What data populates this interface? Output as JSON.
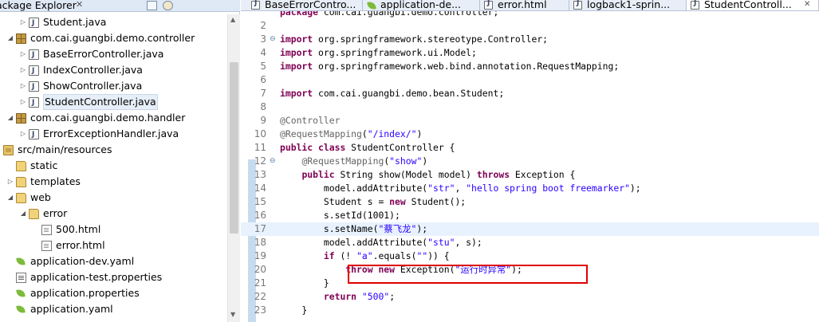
{
  "explorer": {
    "title": "Package Explorer",
    "close_icon": "close-icon",
    "tree": [
      {
        "label": "Student.java",
        "type": "java",
        "indent": 1,
        "arrow": "▷"
      },
      {
        "label": "com.cai.guangbi.demo.controller",
        "type": "package",
        "indent": 0,
        "arrow": "◢"
      },
      {
        "label": "BaseErrorController.java",
        "type": "java",
        "indent": 1,
        "arrow": "▷"
      },
      {
        "label": "IndexController.java",
        "type": "java",
        "indent": 1,
        "arrow": "▷"
      },
      {
        "label": "ShowController.java",
        "type": "java",
        "indent": 1,
        "arrow": "▷"
      },
      {
        "label": "StudentController.java",
        "type": "java",
        "indent": 1,
        "arrow": "▷",
        "selected": true
      },
      {
        "label": "com.cai.guangbi.demo.handler",
        "type": "package",
        "indent": 0,
        "arrow": "◢"
      },
      {
        "label": "ErrorExceptionHandler.java",
        "type": "java",
        "indent": 1,
        "arrow": "▷"
      },
      {
        "label": "src/main/resources",
        "type": "srcfolder",
        "indent": -1,
        "arrow": "◢"
      },
      {
        "label": "static",
        "type": "folder",
        "indent": 0,
        "arrow": ""
      },
      {
        "label": "templates",
        "type": "folder",
        "indent": 0,
        "arrow": "▷"
      },
      {
        "label": "web",
        "type": "folder",
        "indent": 0,
        "arrow": "◢"
      },
      {
        "label": "error",
        "type": "folder",
        "indent": 1,
        "arrow": "◢"
      },
      {
        "label": "500.html",
        "type": "file",
        "indent": 2,
        "arrow": ""
      },
      {
        "label": "error.html",
        "type": "file",
        "indent": 2,
        "arrow": ""
      },
      {
        "label": "application-dev.yaml",
        "type": "yaml",
        "indent": 0,
        "arrow": ""
      },
      {
        "label": "application-test.properties",
        "type": "props",
        "indent": 0,
        "arrow": ""
      },
      {
        "label": "application.properties",
        "type": "yaml",
        "indent": 0,
        "arrow": ""
      },
      {
        "label": "application.yaml",
        "type": "yaml",
        "indent": 0,
        "arrow": ""
      }
    ]
  },
  "editor": {
    "tabs": [
      {
        "label": "BaseErrorContro...",
        "icon": "java-file-icon",
        "active": false
      },
      {
        "label": "application-de...",
        "icon": "yaml-file-icon",
        "active": false
      },
      {
        "label": "error.html",
        "icon": "html-file-icon",
        "active": false
      },
      {
        "label": "logback1-sprin...",
        "icon": "xml-file-icon",
        "active": false
      },
      {
        "label": "StudentControll...",
        "icon": "java-file-icon",
        "active": true,
        "close": "✕"
      }
    ],
    "lines": [
      {
        "n": "",
        "code": "package com.cai.guangbi.demo.controller;"
      },
      {
        "n": "2",
        "code": ""
      },
      {
        "n": "3",
        "code": "import org.springframework.stereotype.Controller;",
        "fold": "⊖"
      },
      {
        "n": "4",
        "code": "import org.springframework.ui.Model;"
      },
      {
        "n": "5",
        "code": "import org.springframework.web.bind.annotation.RequestMapping;"
      },
      {
        "n": "6",
        "code": ""
      },
      {
        "n": "7",
        "code": "import com.cai.guangbi.demo.bean.Student;"
      },
      {
        "n": "8",
        "code": ""
      },
      {
        "n": "9",
        "code": "@Controller"
      },
      {
        "n": "10",
        "code": "@RequestMapping(\"/index/\")"
      },
      {
        "n": "11",
        "code": "public class StudentController {"
      },
      {
        "n": "12",
        "code": "    @RequestMapping(\"show\")",
        "fold": "⊖"
      },
      {
        "n": "13",
        "code": "    public String show(Model model) throws Exception {"
      },
      {
        "n": "14",
        "code": "        model.addAttribute(\"str\", \"hello spring boot freemarker\");"
      },
      {
        "n": "15",
        "code": "        Student s = new Student();"
      },
      {
        "n": "16",
        "code": "        s.setId(1001);"
      },
      {
        "n": "17",
        "code": "        s.setName(\"蔡飞龙\");",
        "current": true
      },
      {
        "n": "18",
        "code": "        model.addAttribute(\"stu\", s);"
      },
      {
        "n": "19",
        "code": "        if (! \"a\".equals(\"\")) {"
      },
      {
        "n": "20",
        "code": "            throw new Exception(\"运行时异常\");"
      },
      {
        "n": "21",
        "code": "        }"
      },
      {
        "n": "22",
        "code": "        return \"500\";"
      },
      {
        "n": "23",
        "code": "    }"
      }
    ]
  },
  "colors": {
    "keyword": "#7f0055",
    "string": "#2a00ff",
    "annotation": "#646464",
    "highlight_box": "#e00000"
  }
}
